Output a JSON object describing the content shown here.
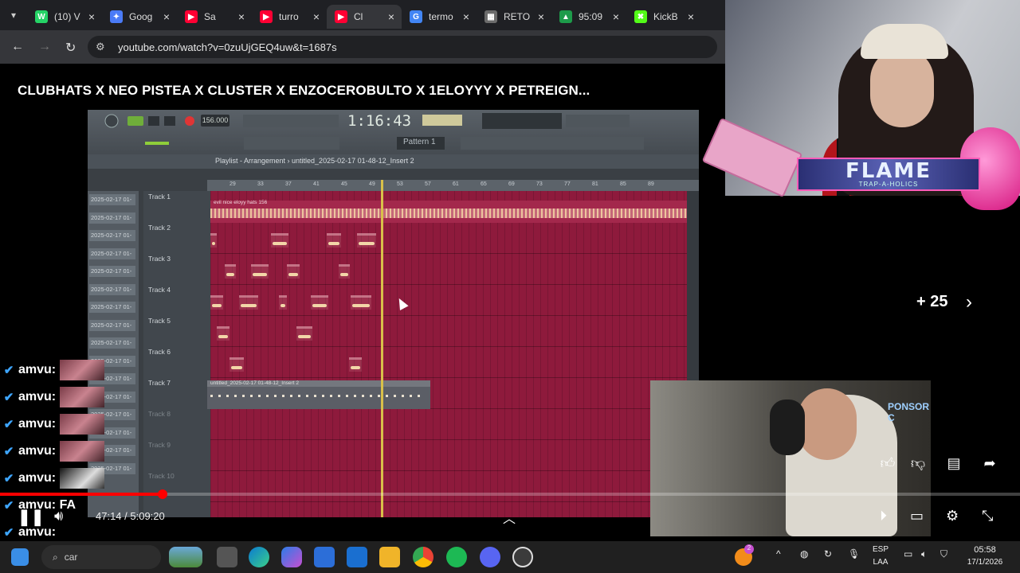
{
  "browser": {
    "tabs": [
      {
        "label": "(10) V",
        "icon": "whatsapp-icon",
        "color": "#25d366",
        "glyph": "W"
      },
      {
        "label": "Goog",
        "icon": "gemini-icon",
        "color": "#4a7bf7",
        "glyph": "✦"
      },
      {
        "label": "Sa",
        "icon": "youtube-icon",
        "color": "#ff0033",
        "glyph": "▶"
      },
      {
        "label": "turro",
        "icon": "youtube-icon",
        "color": "#ff0033",
        "glyph": "▶"
      },
      {
        "label": "Cl",
        "icon": "youtube-icon",
        "color": "#ff0033",
        "glyph": "▶"
      },
      {
        "label": "termo",
        "icon": "google-icon",
        "color": "#4285f4",
        "glyph": "G"
      },
      {
        "label": "RETO",
        "icon": "sheet-icon",
        "color": "#6b6b6b",
        "glyph": "▦"
      },
      {
        "label": "95:09",
        "icon": "chart-icon",
        "color": "#1d9b4a",
        "glyph": "▲"
      },
      {
        "label": "KickB",
        "icon": "kick-icon",
        "color": "#53fc18",
        "glyph": "✖"
      }
    ],
    "url": "youtube.com/watch?v=0zuUjGEQ4uw&t=1687s"
  },
  "video": {
    "title": "CLUBHATS X NEO PISTEA X CLUSTER X ENZOCEROBULTO X 1ELOYYY X PETREIGN...",
    "current_time": "47:14",
    "duration": "5:09:20",
    "time_display": "47:14 / 5:09:20",
    "progress_fraction": 0.153,
    "more_count": "+ 25"
  },
  "fl_studio": {
    "time": "1:16:43",
    "tempo": "156.000",
    "pattern": "Pattern 1",
    "playlist_title": "Playlist - Arrangement › untitled_2025-02-17 01-48-12_Insert 2",
    "ruler": [
      "29",
      "33",
      "37",
      "41",
      "45",
      "49",
      "53",
      "57",
      "61",
      "65",
      "69",
      "73",
      "77",
      "81",
      "85",
      "89"
    ],
    "tracks": [
      "Track 1",
      "Track 2",
      "Track 3",
      "Track 4",
      "Track 5",
      "Track 6",
      "Track 7",
      "Track 8",
      "Track 9",
      "Track 10"
    ],
    "left_items": [
      "2025-02-17 01-",
      "2025-02-17 01-",
      "2025-02-17 01-",
      "2025-02-17 01-",
      "2025-02-17 01-",
      "2025-02-17 01-",
      "2025-02-17 01-",
      "2025-02-17 01-",
      "2025-02-17 01-",
      "2025-02-17 01-",
      "2025-02-17 01-",
      "2025-02-17 01-",
      "2025-02-17 01-",
      "2025-02-17 01-",
      "2025-02-17 01-",
      "2025-02-17 01-"
    ],
    "track1_clip": "evil nice eloyy hats 156",
    "track7_clip": "untitled_2025-02-17 01-48-12_Insert 2"
  },
  "overlay": {
    "flame": "FLAME",
    "flame_sub": "TRAP-A-HOLICS",
    "sponsor": "PONSOR C"
  },
  "chat": {
    "rows": [
      {
        "name": "amvu:"
      },
      {
        "name": "amvu:"
      },
      {
        "name": "amvu:"
      },
      {
        "name": "amvu:"
      },
      {
        "name": "amvu:"
      },
      {
        "name": "amvu: FA"
      },
      {
        "name": "amvu:"
      },
      {
        "name": "amvu:"
      }
    ]
  },
  "taskbar": {
    "search_placeholder": "car",
    "lang": "ESP",
    "region": "LAA",
    "time": "05:58",
    "date": "17/1/2026",
    "notification_badge": "2"
  }
}
